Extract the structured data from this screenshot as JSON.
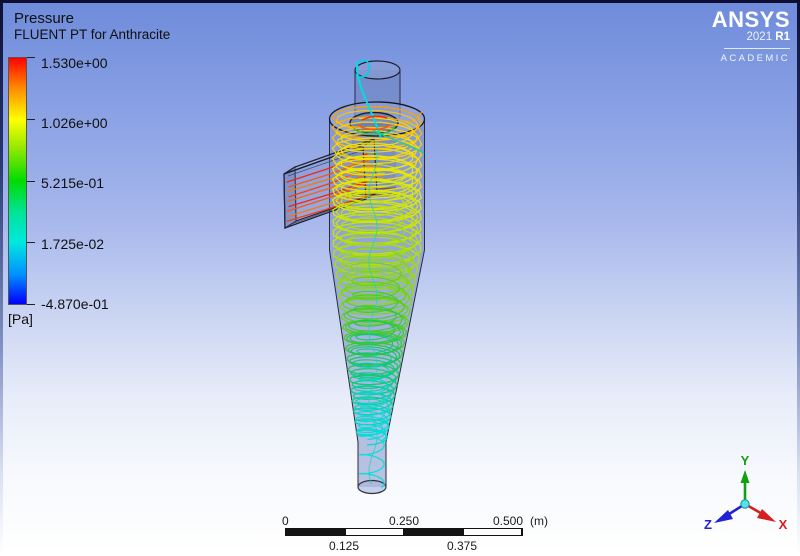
{
  "colorbar": {
    "title": "Pressure",
    "subtitle": "FLUENT PT for Anthracite",
    "unit": "[Pa]",
    "tick_labels": [
      "1.530e+00",
      "1.026e+00",
      "5.215e-01",
      "1.725e-02",
      "-4.870e-01"
    ],
    "gradient_stops": [
      "#ff0000",
      "#ffff00",
      "#00dc00",
      "#00e8e0",
      "#0000ff"
    ]
  },
  "brand": {
    "logo": "ANSYS",
    "version": "2021 ",
    "release": "R1",
    "edition": "ACADEMIC"
  },
  "scale_bar": {
    "label_0": "0",
    "label_mid": "0.250",
    "label_end": "0.500",
    "unit_label": "(m)",
    "label_q1": "0.125",
    "label_q3": "0.375"
  },
  "triad": {
    "axis_x": "X",
    "axis_y": "Y",
    "axis_z": "Z",
    "color_x": "#d42020",
    "color_y": "#12a012",
    "color_z": "#2222d4"
  }
}
